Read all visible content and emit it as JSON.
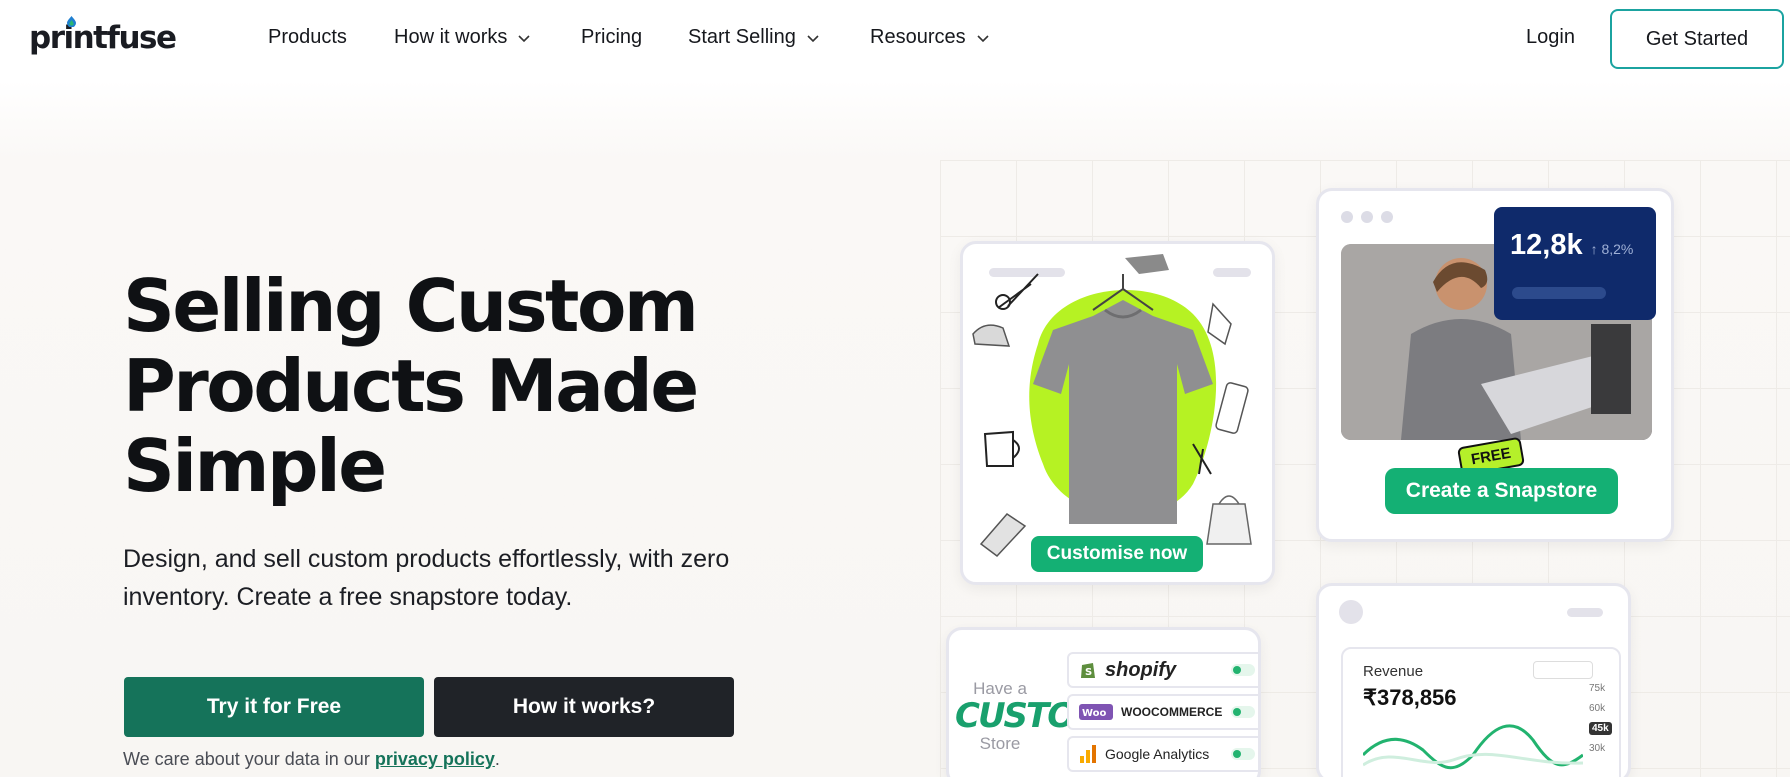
{
  "nav": {
    "logo": "printfuse",
    "items": [
      {
        "label": "Products",
        "has_dropdown": false
      },
      {
        "label": "How it works",
        "has_dropdown": true
      },
      {
        "label": "Pricing",
        "has_dropdown": false
      },
      {
        "label": "Start Selling",
        "has_dropdown": true
      },
      {
        "label": "Resources",
        "has_dropdown": true
      }
    ],
    "login": "Login",
    "cta": "Get Started"
  },
  "hero": {
    "title_lines": [
      "Selling Custom",
      "Products Made",
      "Simple"
    ],
    "subtitle": "Design, and sell custom products effortlessly, with zero inventory. Create a free snapstore today.",
    "primary_button": "Try it for Free",
    "secondary_button": "How it works?",
    "privacy_prefix": "We care about your data in our ",
    "privacy_link": "privacy policy",
    "privacy_suffix": "."
  },
  "illustration": {
    "customise_button": "Customise now",
    "stat_value": "12,8k",
    "stat_change": "↑ 8,2%",
    "free_tag": "FREE",
    "snapstore_button": "Create a Snapstore",
    "custom_store": {
      "line1": "Have a",
      "line2": "CUSTOM",
      "line3": "Store"
    },
    "integrations": [
      "shopify",
      "WOOCOMMERCE",
      "Google Analytics"
    ],
    "revenue_label": "Revenue",
    "revenue_value": "₹378,856",
    "y_ticks": [
      "75k",
      "60k",
      "45k",
      "30k"
    ]
  },
  "colors": {
    "brand_green": "#15735a",
    "accent_green": "#14b074",
    "dark_button": "#202328",
    "cta_border": "#1ba3a0",
    "stat_navy": "#0f2a6b",
    "lime": "#b5f02a"
  }
}
